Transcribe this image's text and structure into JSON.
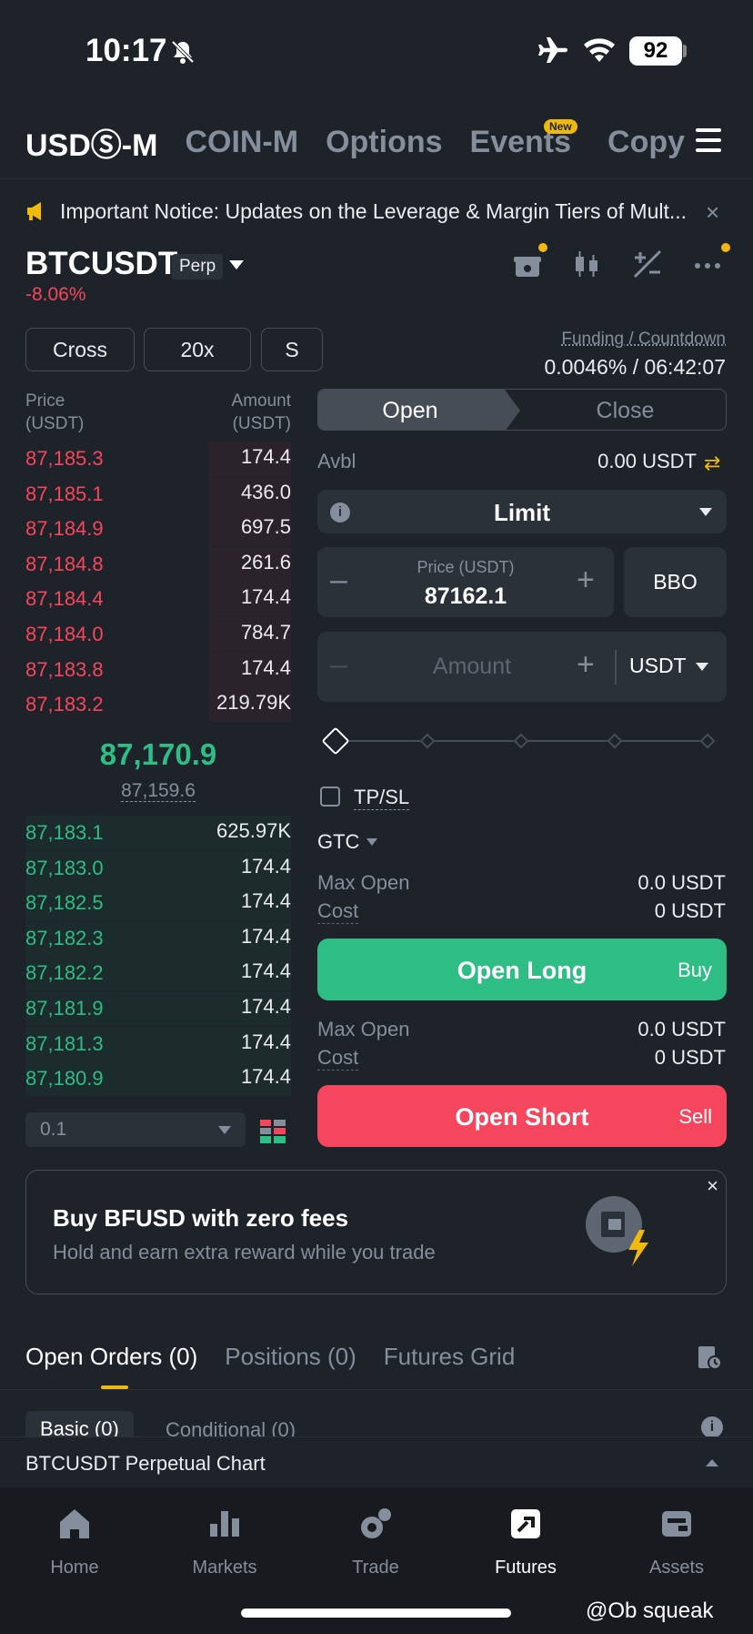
{
  "status_bar": {
    "time": "10:17",
    "battery": "92"
  },
  "top_tabs": [
    {
      "label": "USDⓈ-M",
      "active": true
    },
    {
      "label": "COIN-M",
      "active": false
    },
    {
      "label": "Options",
      "active": false
    },
    {
      "label": "Events",
      "active": false
    },
    {
      "label": "Copy",
      "active": false
    }
  ],
  "new_badge": "New",
  "notice": {
    "text": "Important Notice: Updates on the Leverage & Margin Tiers of Mult...",
    "close": "×"
  },
  "symbol": {
    "name": "BTCUSDT",
    "badge": "Perp",
    "change": "-8.06%"
  },
  "margin": {
    "mode": "Cross",
    "leverage": "20x",
    "asset_mode": "S"
  },
  "funding": {
    "label": "Funding / Countdown",
    "value": "0.0046% / 06:42:07"
  },
  "orderbook": {
    "price_header": "Price",
    "price_unit": "(USDT)",
    "amount_header": "Amount",
    "amount_unit": "(USDT)",
    "asks": [
      {
        "price": "87,185.3",
        "amount": "174.4",
        "depth": 0.31
      },
      {
        "price": "87,185.1",
        "amount": "436.0",
        "depth": 0.31
      },
      {
        "price": "87,184.9",
        "amount": "697.5",
        "depth": 0.31
      },
      {
        "price": "87,184.8",
        "amount": "261.6",
        "depth": 0.31
      },
      {
        "price": "87,184.4",
        "amount": "174.4",
        "depth": 0.31
      },
      {
        "price": "87,184.0",
        "amount": "784.7",
        "depth": 0.31
      },
      {
        "price": "87,183.8",
        "amount": "174.4",
        "depth": 0.31
      },
      {
        "price": "87,183.2",
        "amount": "219.79K",
        "depth": 0.31
      }
    ],
    "last_price": "87,170.9",
    "mark_price": "87,159.6",
    "bids": [
      {
        "price": "87,183.1",
        "amount": "625.97K",
        "depth": 1.0
      },
      {
        "price": "87,183.0",
        "amount": "174.4",
        "depth": 1.0
      },
      {
        "price": "87,182.5",
        "amount": "174.4",
        "depth": 1.0
      },
      {
        "price": "87,182.3",
        "amount": "174.4",
        "depth": 1.0
      },
      {
        "price": "87,182.2",
        "amount": "174.4",
        "depth": 1.0
      },
      {
        "price": "87,181.9",
        "amount": "174.4",
        "depth": 1.0
      },
      {
        "price": "87,181.3",
        "amount": "174.4",
        "depth": 1.0
      },
      {
        "price": "87,180.9",
        "amount": "174.4",
        "depth": 1.0
      }
    ],
    "depth_step": "0.1"
  },
  "form": {
    "open_label": "Open",
    "close_label": "Close",
    "avbl_label": "Avbl",
    "avbl_value": "0.00 USDT",
    "order_type": "Limit",
    "price_label": "Price (USDT)",
    "price_value": "87162.1",
    "bbo_label": "BBO",
    "amount_placeholder": "Amount",
    "amount_unit": "USDT",
    "slider_percent": 0,
    "tpsl_label": "TP/SL",
    "tif": "GTC",
    "max_open_label": "Max Open",
    "cost_label": "Cost",
    "long_max_open": "0.0 USDT",
    "long_cost": "0 USDT",
    "open_long_label": "Open Long",
    "buy_label": "Buy",
    "short_max_open": "0.0 USDT",
    "short_cost": "0 USDT",
    "open_short_label": "Open Short",
    "sell_label": "Sell"
  },
  "promo": {
    "title": "Buy BFUSD with zero fees",
    "subtitle": "Hold and earn extra reward while you trade",
    "close": "×"
  },
  "orders_tabs": [
    {
      "label": "Open Orders (0)",
      "active": true
    },
    {
      "label": "Positions (0)",
      "active": false
    },
    {
      "label": "Futures Grid",
      "active": false
    }
  ],
  "order_subtabs": {
    "basic": "Basic (0)",
    "conditional": "Conditional (0)"
  },
  "chart_bar": {
    "label": "BTCUSDT Perpetual  Chart"
  },
  "bottom_nav": [
    {
      "label": "Home",
      "icon": "home-icon",
      "active": false
    },
    {
      "label": "Markets",
      "icon": "markets-icon",
      "active": false
    },
    {
      "label": "Trade",
      "icon": "trade-icon",
      "active": false
    },
    {
      "label": "Futures",
      "icon": "futures-icon",
      "active": true
    },
    {
      "label": "Assets",
      "icon": "assets-icon",
      "active": false
    }
  ],
  "watermark": "@Ob squeak",
  "colors": {
    "up": "#2ebd85",
    "down": "#f6465d",
    "accent": "#f0b90b",
    "bg": "#1e2329"
  }
}
